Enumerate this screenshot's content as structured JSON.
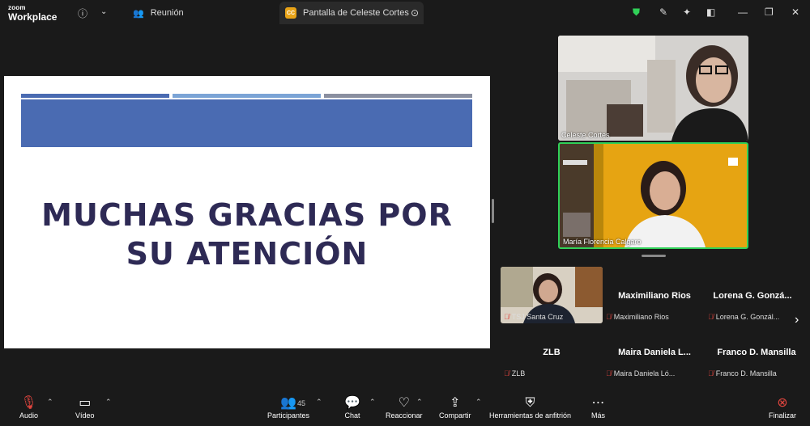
{
  "app": {
    "logo_line1": "zoom",
    "logo_line2": "Workplace"
  },
  "tabs": [
    {
      "label": "Reunión"
    },
    {
      "label": "Pantalla de Celeste Cortes",
      "badge": "CC"
    }
  ],
  "slide": {
    "line1": "MUCHAS GRACIAS POR",
    "line2": "SU ATENCIÓN",
    "bar_colors": [
      "#4a6bb2",
      "#7ba4d6",
      "#8a8fa0"
    ],
    "banner_color": "#4a6bb2"
  },
  "videos": [
    {
      "name": "Celeste Cortes"
    },
    {
      "name": "María Florencia Calgaro"
    }
  ],
  "participants": [
    {
      "tag": "TSJ Santa Cruz"
    },
    {
      "title": "Maximiliano Rios",
      "tag": "Maximiliano Rios"
    },
    {
      "title": "Lorena G. Gonzá...",
      "tag": "Lorena G. Gonzál..."
    },
    {
      "title": "ZLB",
      "tag": "ZLB"
    },
    {
      "title": "Maira Daniela L...",
      "tag": "Maira Daniela Ló..."
    },
    {
      "title": "Franco D. Mansilla",
      "tag": "Franco D. Mansilla"
    }
  ],
  "toolbar": {
    "audio": "Audio",
    "video": "Vídeo",
    "participants": "Participantes",
    "participants_count": "45",
    "chat": "Chat",
    "react": "Reaccionar",
    "share": "Compartir",
    "host_tools": "Herramientas de anfitrión",
    "more": "Más",
    "end": "Finalizar"
  },
  "colors": {
    "accent_green": "#30d158",
    "mute_red": "#e0453e",
    "end_red": "#e0453e"
  }
}
